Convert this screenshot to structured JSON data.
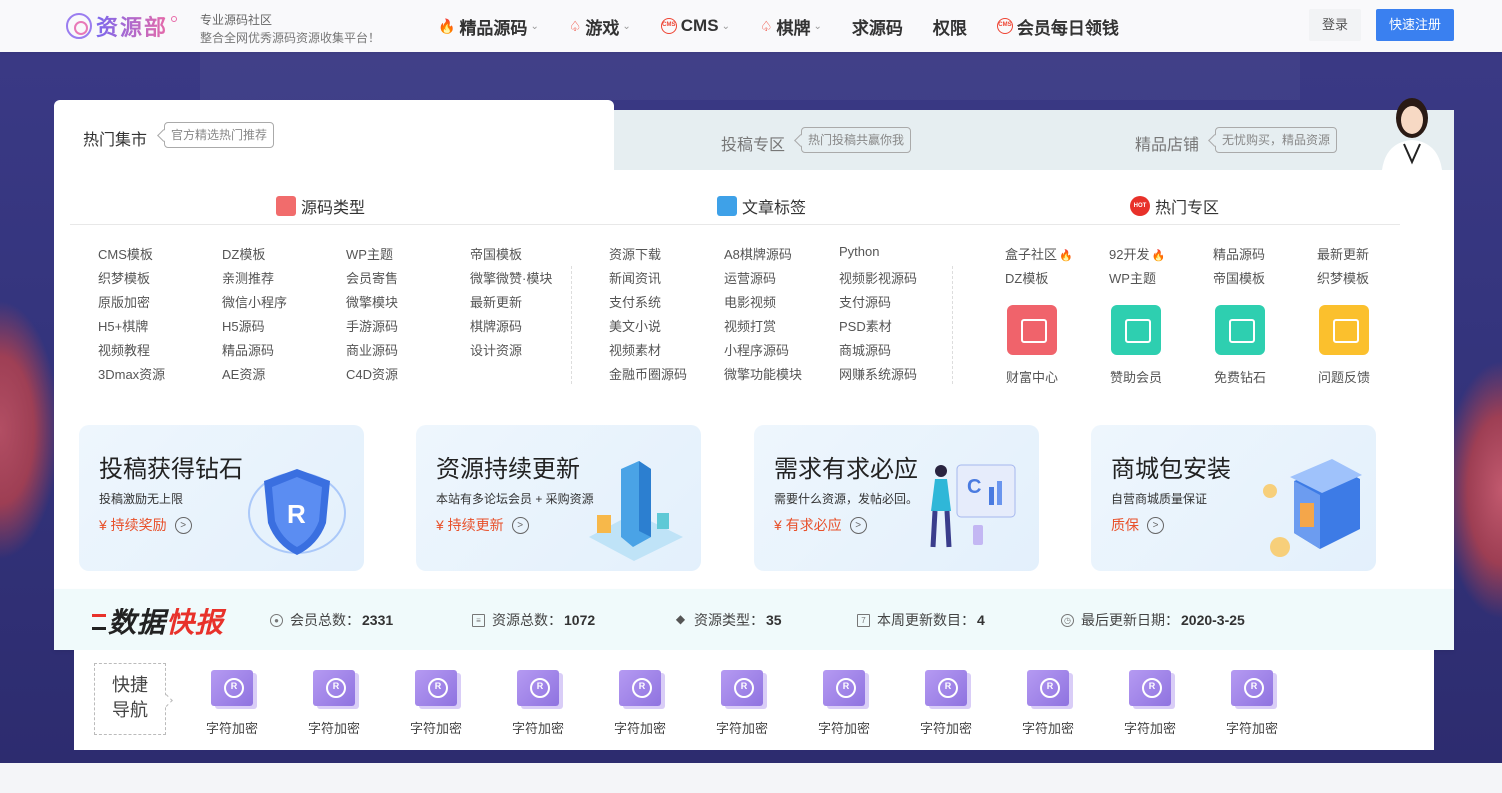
{
  "header": {
    "logo_text": "资源部",
    "slogan_line1": "专业源码社区",
    "slogan_line2": "整合全网优秀源码资源收集平台！",
    "nav": [
      {
        "label": "精品源码",
        "icon": "fire-icon",
        "dropdown": true
      },
      {
        "label": "游戏",
        "icon": "spade-icon",
        "dropdown": true
      },
      {
        "label": "CMS",
        "icon": "cms-icon",
        "dropdown": true
      },
      {
        "label": "棋牌",
        "icon": "spade-icon",
        "dropdown": true
      },
      {
        "label": "求源码",
        "icon": "",
        "dropdown": false
      },
      {
        "label": "权限",
        "icon": "",
        "dropdown": false
      },
      {
        "label": "会员每日领钱",
        "icon": "cms-icon",
        "dropdown": false
      }
    ],
    "login_label": "登录",
    "register_label": "快速注册"
  },
  "tabs": {
    "hot_market": {
      "label": "热门集市",
      "tag": "官方精选热门推荐"
    },
    "submission": {
      "label": "投稿专区",
      "tag": "热门投稿共赢你我"
    },
    "shop": {
      "label": "精品店铺",
      "tag": "无忧购买，精品资源"
    }
  },
  "columns": {
    "source_types": {
      "title": "源码类型",
      "links": [
        [
          "CMS模板",
          "DZ模板",
          "WP主题",
          "帝国模板"
        ],
        [
          "织梦模板",
          "亲测推荐",
          "会员寄售",
          "微擎微赞·模块"
        ],
        [
          "原版加密",
          "微信小程序",
          "微擎模块",
          "最新更新"
        ],
        [
          "H5+棋牌",
          "H5源码",
          "手游源码",
          "棋牌源码"
        ],
        [
          "视频教程",
          "精品源码",
          "商业源码",
          "设计资源"
        ],
        [
          "3Dmax资源",
          "AE资源",
          "C4D资源",
          ""
        ]
      ]
    },
    "article_tags": {
      "title": "文章标签",
      "links": [
        [
          "资源下载",
          "A8棋牌源码",
          "Python"
        ],
        [
          "新闻资讯",
          "运营源码",
          "视频影视源码"
        ],
        [
          "支付系统",
          "电影视频",
          "支付源码"
        ],
        [
          "美文小说",
          "视频打赏",
          "PSD素材"
        ],
        [
          "视频素材",
          "小程序源码",
          "商城源码"
        ],
        [
          "金融币圈源码",
          "微擎功能模块",
          "网赚系统源码"
        ]
      ]
    },
    "hot_zone": {
      "title": "热门专区",
      "hot_badge": "HOT",
      "links": [
        [
          "盒子社区",
          "92开发",
          "精品源码",
          "最新更新"
        ],
        [
          "DZ模板",
          "WP主题",
          "帝国模板",
          "织梦模板"
        ]
      ],
      "apps": [
        {
          "label": "财富中心",
          "color": "#f0636b"
        },
        {
          "label": "赞助会员",
          "color": "#2ecfb0"
        },
        {
          "label": "免费钻石",
          "color": "#2ecfb0"
        },
        {
          "label": "问题反馈",
          "color": "#fbc02d"
        }
      ]
    }
  },
  "cards": [
    {
      "title": "投稿获得钻石",
      "desc": "投稿激励无上限",
      "link": "¥ 持续奖励"
    },
    {
      "title": "资源持续更新",
      "desc": "本站有多论坛会员 + 采购资源",
      "link": "¥ 持续更新"
    },
    {
      "title": "需求有求必应",
      "desc": "需要什么资源，发帖必回。",
      "link": "¥  有求必应"
    },
    {
      "title": "商城包安装",
      "desc": "自营商城质量保证",
      "link": "质保"
    }
  ],
  "stats": {
    "brand_black": "数据",
    "brand_red": "快报",
    "items": [
      {
        "label": "会员总数：",
        "value": "2331"
      },
      {
        "label": "资源总数：",
        "value": "1072"
      },
      {
        "label": "资源类型：",
        "value": "35"
      },
      {
        "label": "本周更新数目：",
        "value": "4"
      },
      {
        "label": "最后更新日期：",
        "value": "2020-3-25"
      }
    ]
  },
  "quick_nav": {
    "title_line1": "快捷",
    "title_line2": "导航",
    "items": [
      "字符加密",
      "字符加密",
      "字符加密",
      "字符加密",
      "字符加密",
      "字符加密",
      "字符加密",
      "字符加密",
      "字符加密",
      "字符加密",
      "字符加密"
    ]
  },
  "colors": {
    "accent_blue": "#3a80f0",
    "accent_red": "#e8312a",
    "hero_bg": "#35357e"
  }
}
